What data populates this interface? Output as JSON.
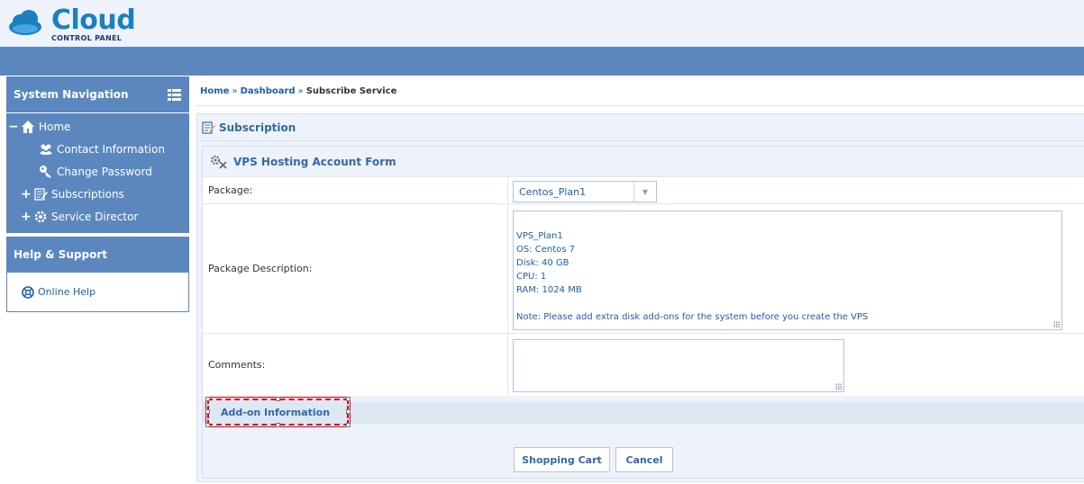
{
  "header": {
    "logo_title": "Cloud",
    "logo_subtitle": "CONTROL PANEL"
  },
  "sidebar": {
    "nav_title": "System Navigation",
    "items": [
      {
        "label": "Home",
        "toggle": "−",
        "icon": "home-icon"
      },
      {
        "label": "Contact Information",
        "toggle": "",
        "icon": "users-icon"
      },
      {
        "label": "Change Password",
        "toggle": "",
        "icon": "key-icon"
      },
      {
        "label": "Subscriptions",
        "toggle": "+",
        "icon": "subscription-icon"
      },
      {
        "label": "Service Director",
        "toggle": "+",
        "icon": "gear-icon"
      }
    ],
    "help_title": "Help & Support",
    "help_link": "Online Help"
  },
  "breadcrumb": {
    "home": "Home",
    "sep": "»",
    "dashboard": "Dashboard",
    "current": "Subscribe Service"
  },
  "panel": {
    "title": "Subscription",
    "form_title": "VPS Hosting Account Form",
    "package_label": "Package:",
    "package_value": "Centos_Plan1",
    "description_label": "Package Description:",
    "description_value": "VPS_Plan1\nOS: Centos 7\nDisk: 40 GB\nCPU: 1\nRAM: 1024 MB\n\nNote: Please add extra disk add-ons for the system before you create the VPS",
    "comments_label": "Comments:",
    "comments_value": "",
    "addon_label": "Add-on Information",
    "cart_button": "Shopping Cart",
    "cancel_button": "Cancel"
  },
  "colors": {
    "nav_blue": "#5b87be",
    "link_blue": "#1e5eaa",
    "highlight_red": "#d0021b"
  }
}
